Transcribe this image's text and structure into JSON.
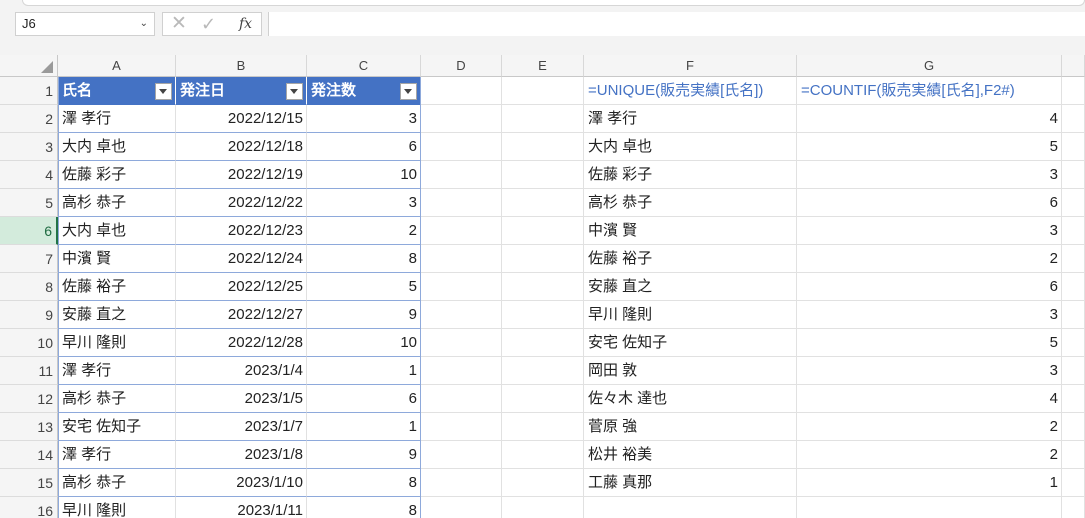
{
  "name_box": {
    "value": "J6"
  },
  "formula_bar": {
    "fx_label": "fx",
    "value": ""
  },
  "columns": [
    "A",
    "B",
    "C",
    "D",
    "E",
    "F",
    "G"
  ],
  "rows": [
    "1",
    "2",
    "3",
    "4",
    "5",
    "6",
    "7",
    "8",
    "9",
    "10",
    "11",
    "12",
    "13",
    "14",
    "15",
    "16"
  ],
  "selected_row": "6",
  "table": {
    "headers": [
      "氏名",
      "発注日",
      "発注数"
    ],
    "rows": [
      [
        "澤 孝行",
        "2022/12/15",
        "3"
      ],
      [
        "大内 卓也",
        "2022/12/18",
        "6"
      ],
      [
        "佐藤 彩子",
        "2022/12/19",
        "10"
      ],
      [
        "高杉 恭子",
        "2022/12/22",
        "3"
      ],
      [
        "大内 卓也",
        "2022/12/23",
        "2"
      ],
      [
        "中濱 賢",
        "2022/12/24",
        "8"
      ],
      [
        "佐藤 裕子",
        "2022/12/25",
        "5"
      ],
      [
        "安藤 直之",
        "2022/12/27",
        "9"
      ],
      [
        "早川 隆則",
        "2022/12/28",
        "10"
      ],
      [
        "澤 孝行",
        "2023/1/4",
        "1"
      ],
      [
        "高杉 恭子",
        "2023/1/5",
        "6"
      ],
      [
        "安宅 佐知子",
        "2023/1/7",
        "1"
      ],
      [
        "澤 孝行",
        "2023/1/8",
        "9"
      ],
      [
        "高杉 恭子",
        "2023/1/10",
        "8"
      ],
      [
        "早川 隆則",
        "2023/1/11",
        "8"
      ]
    ]
  },
  "formulas": {
    "F1": "=UNIQUE(販売実績[氏名])",
    "G1": "=COUNTIF(販売実績[氏名],F2#)"
  },
  "unique_results": [
    [
      "澤 孝行",
      "4"
    ],
    [
      "大内 卓也",
      "5"
    ],
    [
      "佐藤 彩子",
      "3"
    ],
    [
      "高杉 恭子",
      "6"
    ],
    [
      "中濱 賢",
      "3"
    ],
    [
      "佐藤 裕子",
      "2"
    ],
    [
      "安藤 直之",
      "6"
    ],
    [
      "早川 隆則",
      "3"
    ],
    [
      "安宅 佐知子",
      "5"
    ],
    [
      "岡田 敦",
      "3"
    ],
    [
      "佐々木 達也",
      "4"
    ],
    [
      "菅原 強",
      "2"
    ],
    [
      "松井 裕美",
      "2"
    ],
    [
      "工藤 真那",
      "1"
    ]
  ],
  "colors": {
    "table_header": "#4472c4",
    "formula_text": "#4472c4",
    "selection": "#217346"
  }
}
